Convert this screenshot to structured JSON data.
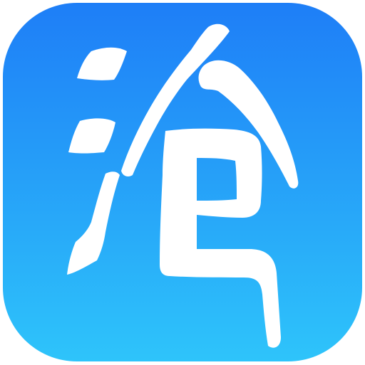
{
  "app_icon": {
    "glyph": "沧",
    "gradient_top": "#1E7EF7",
    "gradient_bottom": "#2EC4FA",
    "glyph_color": "#FFFFFF",
    "background": "#FFFFFF"
  }
}
